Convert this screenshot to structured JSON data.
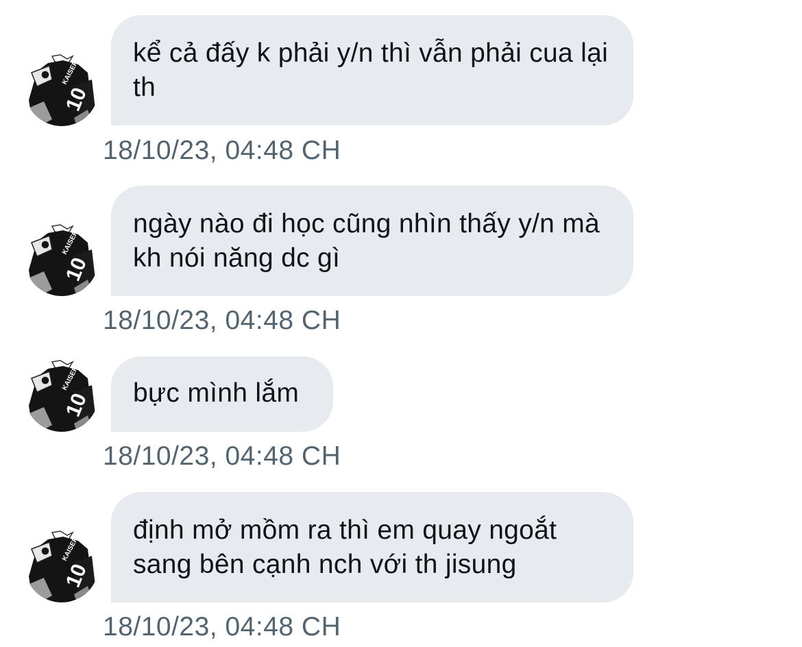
{
  "conversation": {
    "messages": [
      {
        "text": "kể cả đấy k phải y/n thì vẫn phải cua lại th",
        "timestamp": "18/10/23, 04:48 CH",
        "avatar_icon": "kaiser-avatar-icon"
      },
      {
        "text": "ngày nào đi học cũng nhìn thấy y/n mà kh nói năng dc gì",
        "timestamp": "18/10/23, 04:48 CH",
        "avatar_icon": "kaiser-avatar-icon"
      },
      {
        "text": "bực mình lắm",
        "timestamp": "18/10/23, 04:48 CH",
        "avatar_icon": "kaiser-avatar-icon"
      },
      {
        "text": "định mở mồm ra thì em quay ngoắt sang bên cạnh nch với th jisung",
        "timestamp": "18/10/23, 04:48 CH",
        "avatar_icon": "kaiser-avatar-icon"
      }
    ]
  },
  "avatar": {
    "jersey_name": "KAISER",
    "jersey_number": "10"
  },
  "colors": {
    "bubble": "#e7ebef",
    "text": "#0f1419",
    "timestamp": "#536471",
    "background": "#ffffff"
  }
}
